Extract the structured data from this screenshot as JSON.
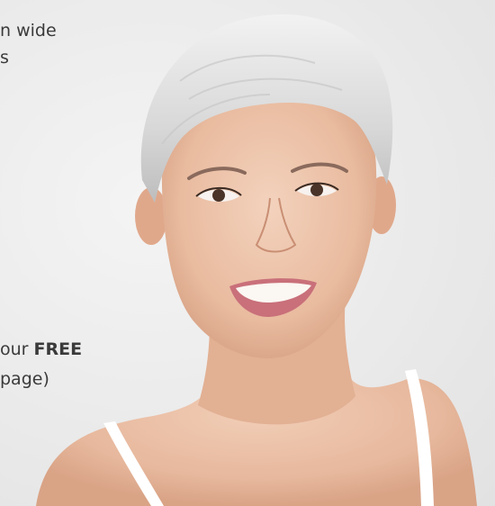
{
  "text_lines": {
    "line1": "n wide",
    "line2": "s",
    "line3_prefix": "our ",
    "line3_bold": "FREE",
    "line4": "page)"
  },
  "photo": {
    "subject": "smiling-woman-portrait",
    "background_color": "#ececec",
    "hair_color": "#dcdcdc",
    "skin_color": "#e9bfa7",
    "strap_color": "#ffffff"
  }
}
